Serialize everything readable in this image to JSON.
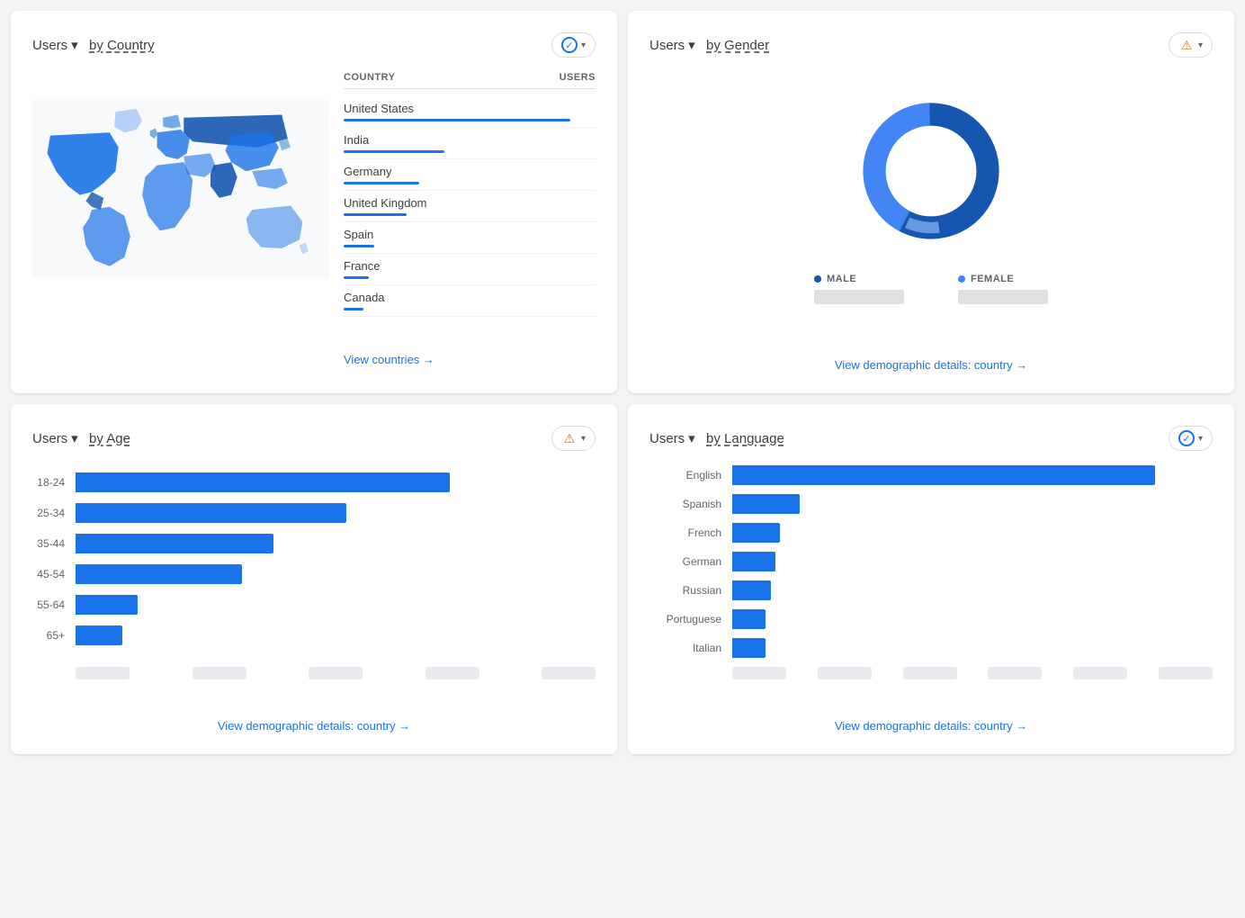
{
  "countryCard": {
    "title": "Users",
    "titleBy": "by Country",
    "underlinePart": "by Country",
    "dropdownLabel": "check",
    "tableHeaders": {
      "country": "COUNTRY",
      "users": "USERS"
    },
    "countries": [
      {
        "name": "United States",
        "barWidth": "90%"
      },
      {
        "name": "India",
        "barWidth": "40%"
      },
      {
        "name": "Germany",
        "barWidth": "30%"
      },
      {
        "name": "United Kingdom",
        "barWidth": "25%"
      },
      {
        "name": "Spain",
        "barWidth": "12%"
      },
      {
        "name": "France",
        "barWidth": "10%"
      },
      {
        "name": "Canada",
        "barWidth": "8%"
      }
    ],
    "viewLink": "View countries →"
  },
  "genderCard": {
    "title": "Users",
    "titleBy": "by Gender",
    "underlinePart": "by Gender",
    "dropdownLabel": "warn",
    "donut": {
      "malePercent": 58,
      "femalePercent": 42,
      "maleColor": "#1a73e8",
      "femaleColor": "#4285f4",
      "innerColor": "#8ab4f8"
    },
    "legend": {
      "maleLabel": "MALE",
      "femaleLabel": "FEMALE"
    },
    "viewLink": "View demographic details: country →"
  },
  "ageCard": {
    "title": "Users",
    "titleBy": "by Age",
    "underlinePart": "by Age",
    "dropdownLabel": "warn",
    "ageGroups": [
      {
        "label": "18-24",
        "width": "72%"
      },
      {
        "label": "25-34",
        "width": "52%"
      },
      {
        "label": "35-44",
        "width": "38%"
      },
      {
        "label": "45-54",
        "width": "32%"
      },
      {
        "label": "55-64",
        "width": "12%"
      },
      {
        "label": "65+",
        "width": "9%"
      }
    ],
    "viewLink": "View demographic details: country →"
  },
  "languageCard": {
    "title": "Users",
    "titleBy": "by Language",
    "underlinePart": "by Language",
    "dropdownLabel": "check",
    "languages": [
      {
        "label": "English",
        "width": "88%"
      },
      {
        "label": "Spanish",
        "width": "14%"
      },
      {
        "label": "French",
        "width": "10%"
      },
      {
        "label": "German",
        "width": "9%"
      },
      {
        "label": "Russian",
        "width": "8%"
      },
      {
        "label": "Portuguese",
        "width": "7%"
      },
      {
        "label": "Italian",
        "width": "7%"
      }
    ],
    "viewLink": "View demographic details: country →"
  }
}
